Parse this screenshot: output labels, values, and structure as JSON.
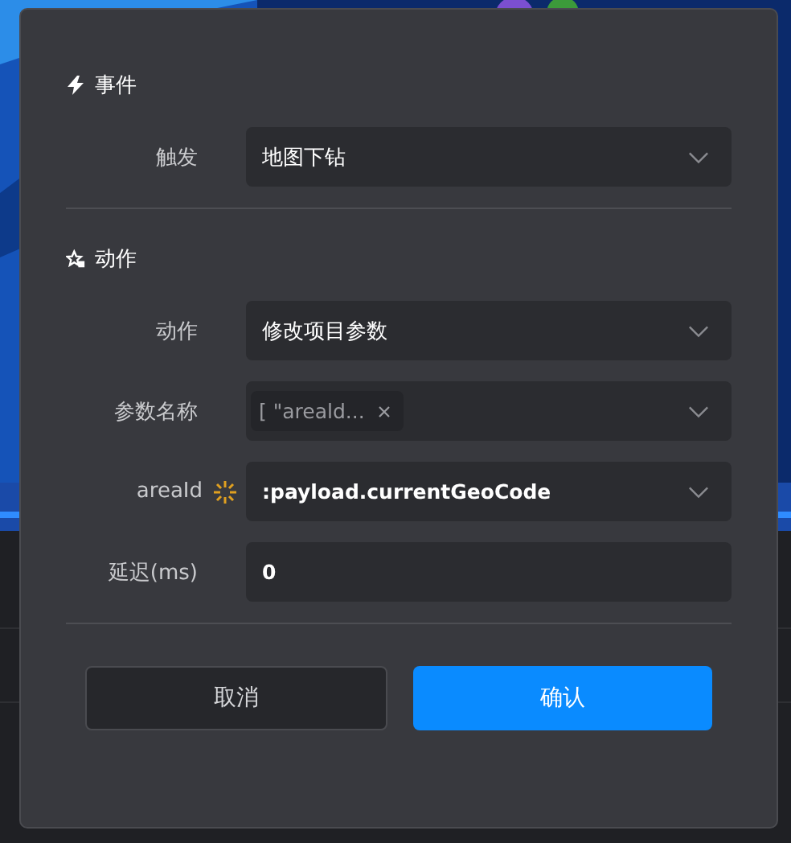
{
  "sections": [
    {
      "title": "事件",
      "kind": "event",
      "fields": [
        {
          "kind": "select",
          "caption": "触发",
          "value": "地图下钻"
        }
      ]
    },
    {
      "title": "动作",
      "kind": "action",
      "fields": [
        {
          "kind": "select",
          "caption": "动作",
          "value": "修改项目参数"
        },
        {
          "kind": "tags",
          "caption": "参数名称",
          "tags": [
            "[ \"areald..."
          ]
        },
        {
          "kind": "binding",
          "caption": "areaId",
          "value": ":payload.currentGeoCode"
        },
        {
          "kind": "input",
          "caption": "延迟(ms)",
          "value": "0"
        }
      ]
    }
  ],
  "buttons": [
    {
      "label": "取消",
      "primary": false
    },
    {
      "label": "确认",
      "primary": true
    }
  ]
}
